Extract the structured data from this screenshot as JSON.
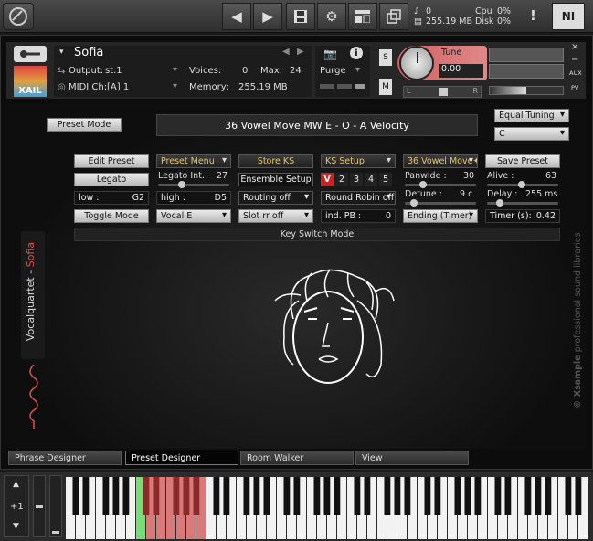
{
  "topbar": {
    "cpu_label": "Cpu",
    "cpu_value": "0%",
    "disk_label": "Disk",
    "disk_value": "0%",
    "voices_count": "0",
    "memory": "255.19 MB",
    "alert": "!",
    "ni": "NI"
  },
  "header": {
    "instrument_name": "Sofia",
    "output_label": "Output:",
    "output_value": "st.1",
    "voices_label": "Voices:",
    "voices_value": "0",
    "max_label": "Max:",
    "max_value": "24",
    "purge_label": "Purge",
    "midi_label": "MIDI Ch:",
    "midi_value": "[A]  1",
    "memory_label": "Memory:",
    "memory_value": "255.19 MB",
    "logo_text": "XAIL",
    "s_label": "S",
    "m_label": "M",
    "tune_label": "Tune",
    "tune_value": "0.00",
    "pan_l": "L",
    "pan_r": "R",
    "aux_label": "AUX",
    "pv_label": "PV",
    "close": "×",
    "minus": "−"
  },
  "controls": {
    "preset_mode": "Preset Mode",
    "preset_name": "36 Vowel Move MW E - O - A Velocity",
    "tuning": "Equal Tuning",
    "key": "C",
    "edit_preset": "Edit Preset",
    "preset_menu": "Preset Menu",
    "store_ks": "Store KS",
    "ks_setup": "KS Setup",
    "vowel_move": "36 Vowel Move✦!!",
    "save_preset": "Save Preset",
    "legato": "Legato",
    "legato_int_label": "Legato Int.:",
    "legato_int_value": "27",
    "ensemble_setup": "Ensemble Setup",
    "ks_num_1": "V",
    "ks_num_2": "2",
    "ks_num_3": "3",
    "ks_num_4": "4",
    "ks_num_5": "5",
    "panwide_label": "Panwide :",
    "panwide_value": "30",
    "alive_label": "Alive :",
    "alive_value": "63",
    "low_label": "low :",
    "low_value": "G2",
    "high_label": "high :",
    "high_value": "D5",
    "routing": "Routing off",
    "round_robin": "Round Robin off",
    "detune_label": "Detune :",
    "detune_value": "9 c",
    "delay_label": "Delay :",
    "delay_value": "255 ms",
    "toggle_mode": "Toggle Mode",
    "vocal": "Vocal E",
    "slot_rr": "Slot rr off",
    "ind_pb_label": "ind. PB :",
    "ind_pb_value": "0",
    "ending": "Ending (Timer)",
    "timer_label": "Timer (s):",
    "timer_value": "0.42",
    "ks_mode": "Key Switch Mode"
  },
  "side": {
    "vertical_title_a": "Vocalquartet - ",
    "vertical_title_b": "Sofia",
    "watermark_a": "© Xsample",
    "watermark_b": " professional sound libraries"
  },
  "tabs": [
    "Phrase Designer",
    "Preset Designer",
    "Room Walker",
    "View"
  ],
  "keyboard": {
    "octave": "+1",
    "highlight_color": "#d87a7a",
    "green_color": "#77dd77"
  }
}
